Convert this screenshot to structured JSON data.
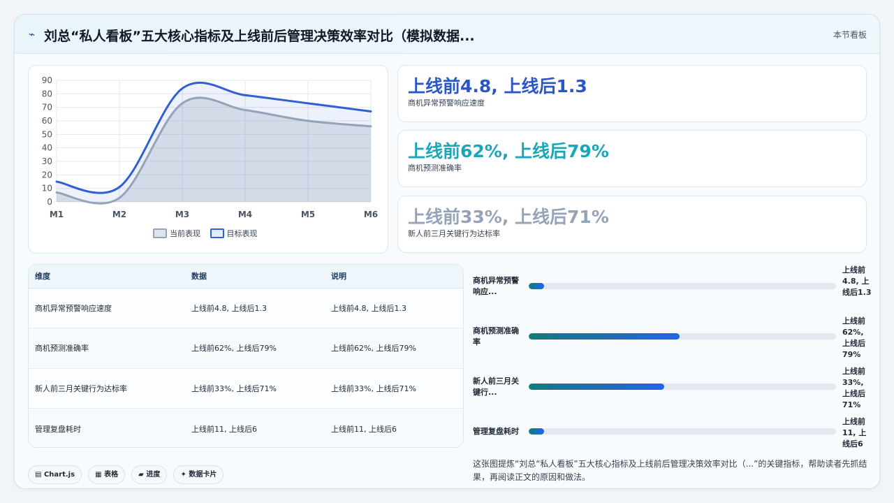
{
  "header": {
    "icon": "sparkline-icon",
    "title": "刘总“私人看板”五大核心指标及上线前后管理决策效率对比（模拟数据...",
    "tag": "本节看板"
  },
  "chart_data": {
    "type": "line",
    "categories": [
      "M1",
      "M2",
      "M3",
      "M4",
      "M5",
      "M6"
    ],
    "ylim": [
      0,
      90
    ],
    "yticks": [
      0,
      10,
      20,
      30,
      40,
      50,
      60,
      70,
      80,
      90
    ],
    "grid": true,
    "legend_position": "bottom",
    "series": [
      {
        "name": "当前表现",
        "values": [
          7,
          3,
          73,
          68,
          60,
          56
        ],
        "color": "#94a3b8"
      },
      {
        "name": "目标表现",
        "values": [
          15,
          11,
          84,
          79,
          73,
          67
        ],
        "color": "#2f5fd0"
      }
    ]
  },
  "stats": [
    {
      "value": "上线前4.8, 上线后1.3",
      "label": "商机异常预警响应速度",
      "color": "#2a56c6"
    },
    {
      "value": "上线前62%, 上线后79%",
      "label": "商机预测准确率",
      "color": "#1aa6b7"
    },
    {
      "value": "上线前33%, 上线后71%",
      "label": "新人前三月关键行为达标率",
      "color": "#94a3b8"
    }
  ],
  "table": {
    "headers": [
      "维度",
      "数据",
      "说明"
    ],
    "rows": [
      [
        "商机异常预警响应速度",
        "上线前4.8, 上线后1.3",
        "上线前4.8, 上线后1.3"
      ],
      [
        "商机预测准确率",
        "上线前62%, 上线后79%",
        "上线前62%, 上线后79%"
      ],
      [
        "新人前三月关键行为达标率",
        "上线前33%, 上线后71%",
        "上线前33%, 上线后71%"
      ],
      [
        "管理复盘耗时",
        "上线前11, 上线后6",
        "上线前11, 上线后6"
      ]
    ]
  },
  "progress": [
    {
      "label": "商机异常预警响应...",
      "value": "上线前4.8, 上线后1.3",
      "fraction": 0.05
    },
    {
      "label": "商机预测准确率",
      "value": "上线前62%, 上线后79%",
      "fraction": 0.49
    },
    {
      "label": "新人前三月关键行...",
      "value": "上线前33%, 上线后71%",
      "fraction": 0.44
    },
    {
      "label": "管理复盘耗时",
      "value": "上线前11, 上线后6",
      "fraction": 0.05
    }
  ],
  "chips": [
    {
      "icon": "chart-icon",
      "glyph": "▤",
      "label": "Chart.js"
    },
    {
      "icon": "table-icon",
      "glyph": "▦",
      "label": "表格"
    },
    {
      "icon": "progress-icon",
      "glyph": "▰",
      "label": "进度"
    },
    {
      "icon": "sparkle-icon",
      "glyph": "✦",
      "label": "数据卡片"
    }
  ],
  "footnote": "这张图提炼“刘总“私人看板”五大核心指标及上线前后管理决策效率对比（...”的关键指标，帮助读者先抓结果，再阅读正文的原因和做法。"
}
